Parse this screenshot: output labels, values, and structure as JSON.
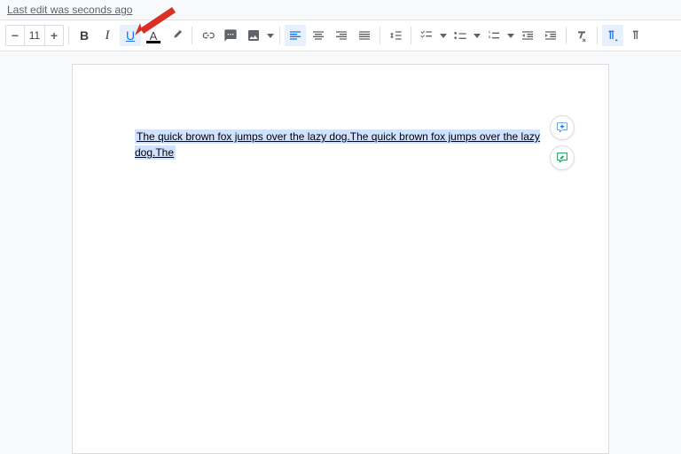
{
  "header": {
    "last_edit": "Last edit was seconds ago"
  },
  "toolbar": {
    "font_size": "11",
    "decrease": "−",
    "increase": "+",
    "bold": "B",
    "italic": "I",
    "underline": "U",
    "text_color": "A"
  },
  "document": {
    "content": "The quick brown fox jumps over the lazy dog.The quick brown fox jumps over the lazy dog.The"
  }
}
